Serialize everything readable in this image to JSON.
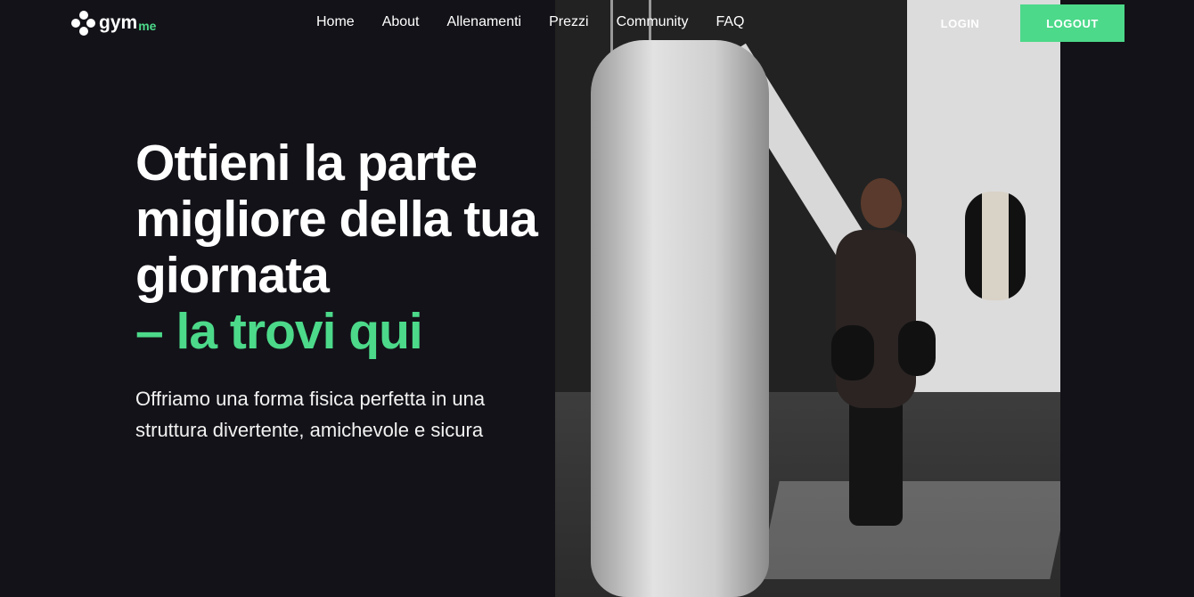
{
  "brand": {
    "name": "gym",
    "suffix": "me",
    "accent_color": "#4cd98a"
  },
  "nav": {
    "items": [
      {
        "label": "Home"
      },
      {
        "label": "About"
      },
      {
        "label": "Allenamenti"
      },
      {
        "label": "Prezzi"
      },
      {
        "label": "Community"
      },
      {
        "label": "FAQ"
      }
    ]
  },
  "auth": {
    "login_label": "LOGIN",
    "logout_label": "LOGOUT"
  },
  "hero": {
    "title_lines": [
      "Ottieni la parte",
      "migliore della tua",
      "giornata"
    ],
    "title_accent": "– la trovi qui",
    "subtitle": "Offriamo una forma fisica perfetta in una struttura divertente, amichevole e sicura"
  },
  "colors": {
    "background": "#131218",
    "accent": "#4cd98a"
  }
}
